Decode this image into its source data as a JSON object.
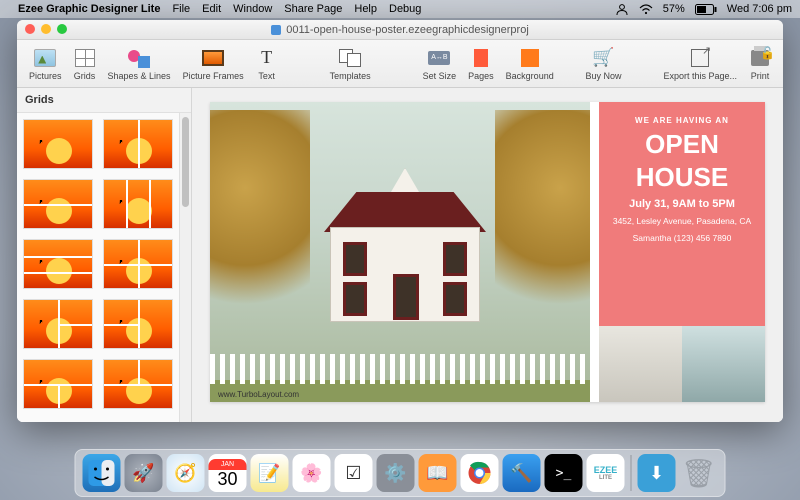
{
  "menubar": {
    "app_name": "Ezee Graphic Designer Lite",
    "items": [
      "File",
      "Edit",
      "Window",
      "Share Page",
      "Help",
      "Debug"
    ],
    "battery": "57%",
    "clock": "Wed 7:06 pm"
  },
  "window": {
    "title": "0011-open-house-poster.ezeegraphicdesignerproj"
  },
  "toolbar": {
    "pictures": "Pictures",
    "grids": "Grids",
    "shapes": "Shapes & Lines",
    "frames": "Picture Frames",
    "text": "Text",
    "templates": "Templates",
    "setsize": "Set Size",
    "pages": "Pages",
    "background": "Background",
    "buynow": "Buy Now",
    "export": "Export this Page...",
    "print": "Print",
    "setsize_badge": "A↔B"
  },
  "sidebar": {
    "title": "Grids"
  },
  "poster": {
    "kicker": "WE ARE HAVING AN",
    "line1": "OPEN",
    "line2": "HOUSE",
    "date": "July 31, 9AM to 5PM",
    "address": "3452, Lesley Avenue, Pasadena, CA",
    "contact": "Samantha  (123) 456 7890",
    "watermark": "www.TurboLayout.com"
  },
  "dock": {
    "cal_month": "JAN",
    "cal_day": "30",
    "ezee": "EZEE"
  }
}
